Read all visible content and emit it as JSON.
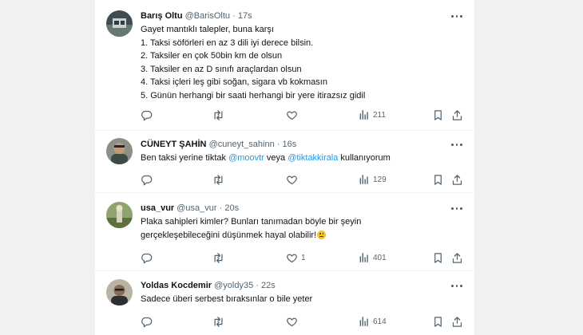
{
  "tweets": [
    {
      "name": "Barış Oltu",
      "handle": "@BarisOltu",
      "time": "17s",
      "lines": [
        "Gayet mantıklı talepler, buna karşı",
        "1. Taksi söförleri en az 3 dili iyi derece bilsin.",
        "2. Taksiler en çok 50bin km de olsun",
        "3. Taksiler en az D sınıfı araçlardan olsun",
        "4. Taksi içleri leş gibi soğan, sigara vb kokmasın",
        "5. Günün herhangi bir saati herhangi bir yere itirazsız gidil"
      ],
      "stats": {
        "replies": "",
        "retweets": "",
        "likes": "",
        "views": "211"
      }
    },
    {
      "name": "CÜNEYT ŞAHİN",
      "handle": "@cuneyt_sahinn",
      "time": "16s",
      "text_parts": {
        "a": "Ben taksi yerine  tiktak ",
        "m1": "@moovtr",
        "b": " veya ",
        "m2": "@tiktakkirala",
        "c": " kullanıyorum"
      },
      "stats": {
        "replies": "",
        "retweets": "",
        "likes": "",
        "views": "129"
      }
    },
    {
      "name": "usa_vur",
      "handle": "@usa_vur",
      "time": "20s",
      "lines": [
        "Plaka sahipleri kimler? Bunları tanımadan böyle bir şeyin",
        "gerçekleşebileceğini düşünmek hayal olabilir!"
      ],
      "emoji": "smirking-face-emoji",
      "stats": {
        "replies": "",
        "retweets": "",
        "likes": "1",
        "views": "401"
      }
    },
    {
      "name": "Yoldas Kocdemir",
      "handle": "@yoldy35",
      "time": "22s",
      "lines": [
        "Sadece überi serbest bıraksınlar o bile yeter"
      ],
      "stats": {
        "replies": "",
        "retweets": "",
        "likes": "",
        "views": "614"
      }
    }
  ],
  "colors": {
    "link": "#1d9bf0",
    "muted": "#536471",
    "text": "#0f1419",
    "page_bg": "#f1f1f1"
  }
}
